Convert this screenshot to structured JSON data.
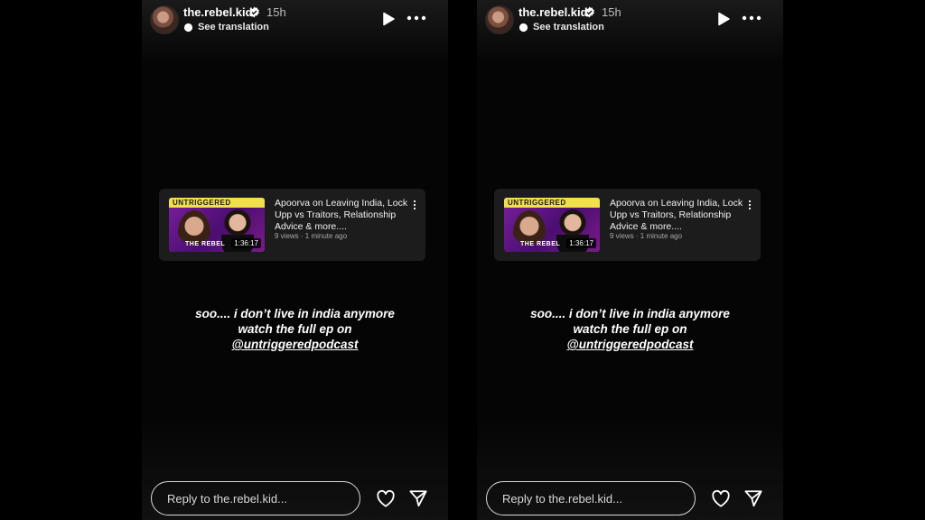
{
  "stories": [
    {
      "username": "the.rebel.kid",
      "time": "15h",
      "see_translation": "See translation",
      "card": {
        "banner": "UNTRIGGERED",
        "thumb_label": "THE REBEL",
        "duration": "1:36:17",
        "title": "Apoorva on Leaving India, Lock Upp vs Traitors, Relationship Advice & more....",
        "meta": "9 views · 1 minute ago"
      },
      "caption": {
        "line1": "soo.... i don’t live in india anymore",
        "line2": "watch the full ep on",
        "mention": "@untriggeredpodcast"
      },
      "reply_placeholder": "Reply to the.rebel.kid..."
    },
    {
      "username": "the.rebel.kid",
      "time": "15h",
      "see_translation": "See translation",
      "card": {
        "banner": "UNTRIGGERED",
        "thumb_label": "THE REBEL",
        "duration": "1:36:17",
        "title": "Apoorva on Leaving India, Lock Upp vs Traitors, Relationship Advice & more....",
        "meta": "9 views · 1 minute ago"
      },
      "caption": {
        "line1": "soo.... i don’t live in india anymore",
        "line2": "watch the full ep on",
        "mention": "@untriggeredpodcast"
      },
      "reply_placeholder": "Reply to the.rebel.kid..."
    }
  ],
  "icons": {
    "verified": "verified-badge-icon",
    "translate": "translate-icon",
    "play": "play-icon",
    "more": "more-horizontal-icon",
    "card_more": "more-vertical-icon",
    "heart": "heart-icon",
    "send": "send-icon"
  },
  "colors": {
    "background": "#000000",
    "panel": "#050505",
    "card": "#1c1c1c",
    "banner": "#f2e04a",
    "thumbnail": "#7a1f9e"
  }
}
